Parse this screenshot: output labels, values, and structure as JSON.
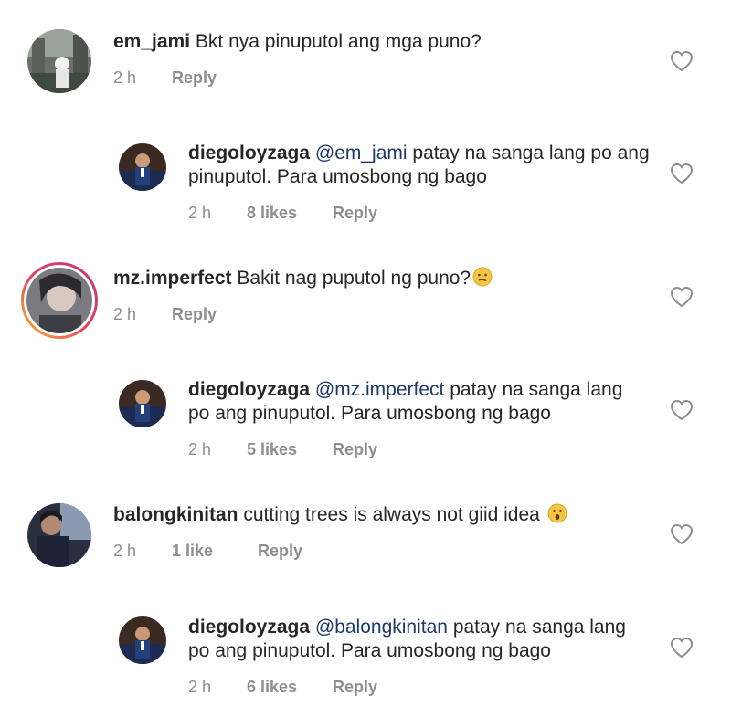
{
  "comments": [
    {
      "username": "em_jami",
      "text": "Bkt nya pinuputol ang mga puno?",
      "time": "2 h",
      "reply": "Reply"
    },
    {
      "username": "diegoloyzaga",
      "mention": "@em_jami",
      "text_line1": "patay na sanga lang po ang",
      "text_line2": "pinuputol. Para umosbong ng bago",
      "time": "2 h",
      "likes": "8 likes",
      "reply": "Reply"
    },
    {
      "username": "mz.imperfect",
      "text": "Bakit nag puputol ng puno?",
      "emoji": "confused-face",
      "time": "2 h",
      "reply": "Reply"
    },
    {
      "username": "diegoloyzaga",
      "mention": "@mz.imperfect",
      "text_line1": "patay na sanga lang",
      "text_line2": "po ang pinuputol. Para umosbong ng bago",
      "time": "2 h",
      "likes": "5 likes",
      "reply": "Reply"
    },
    {
      "username": "balongkinitan",
      "text": "cutting trees is always not giid idea",
      "emoji": "surprised-face",
      "time": "2 h",
      "likes": "1 like",
      "reply": "Reply"
    },
    {
      "username": "diegoloyzaga",
      "mention": "@balongkinitan",
      "text_line1": "patay na sanga lang",
      "text_line2": "po ang pinuputol. Para umosbong ng bago",
      "time": "2 h",
      "likes": "6 likes",
      "reply": "Reply"
    }
  ]
}
